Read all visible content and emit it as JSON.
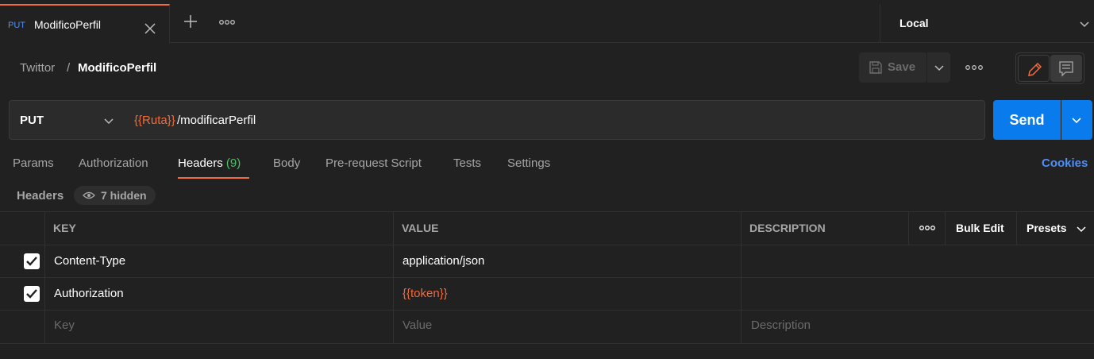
{
  "tabbar": {
    "tab": {
      "method": "PUT",
      "title": "ModificoPerfil"
    },
    "environment": "Local"
  },
  "breadcrumb": {
    "parent": "Twittor",
    "separator": "/",
    "current": "ModificoPerfil"
  },
  "toolbar": {
    "save_label": "Save"
  },
  "request": {
    "method": "PUT",
    "url_variable": "{{Ruta}}",
    "url_path": "/modificarPerfil",
    "send_label": "Send"
  },
  "request_tabs": {
    "params": "Params",
    "authorization": "Authorization",
    "headers": "Headers",
    "headers_count": "(9)",
    "body": "Body",
    "prerequest": "Pre-request Script",
    "tests": "Tests",
    "settings": "Settings",
    "cookies": "Cookies"
  },
  "headers_section": {
    "title": "Headers",
    "hidden": "7 hidden"
  },
  "table": {
    "columns": {
      "key": "KEY",
      "value": "VALUE",
      "description": "DESCRIPTION",
      "bulk_edit": "Bulk Edit",
      "presets": "Presets"
    },
    "rows": [
      {
        "checked": true,
        "key": "Content-Type",
        "value": "application/json",
        "description": ""
      },
      {
        "checked": true,
        "key": "Authorization",
        "value": "{{token}}",
        "description": ""
      }
    ],
    "placeholders": {
      "key": "Key",
      "value": "Value",
      "description": "Description"
    }
  },
  "colors": {
    "accent": "#f26b3a",
    "primary": "#097bed",
    "link": "#4f8ff7",
    "count": "#49c266",
    "background": "#212121"
  }
}
